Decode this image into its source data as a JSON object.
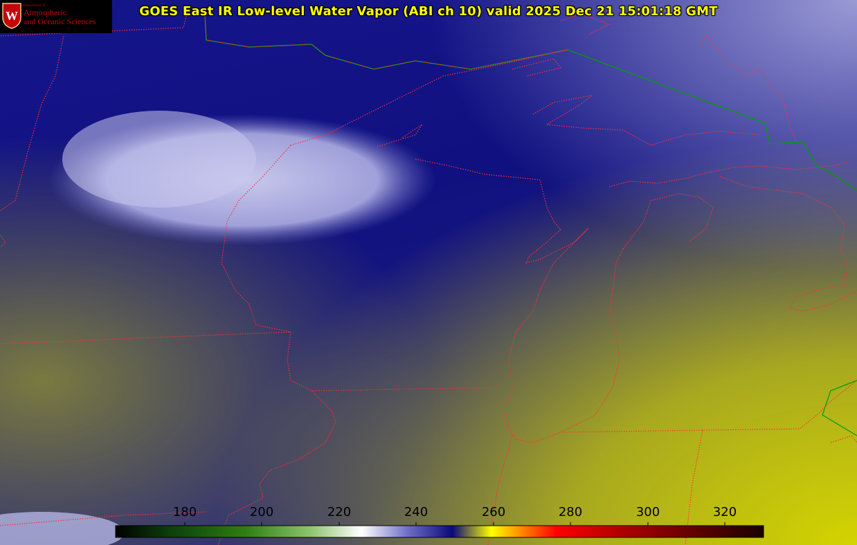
{
  "title": "GOES East IR Low-level Water Vapor (ABI ch 10) valid 2025 Dec 21 15:01:18 GMT",
  "logo": {
    "icon": "uw-crest-icon",
    "dept": "Department of",
    "line1": "Atmospheric",
    "line2": "and Oceanic Sciences"
  },
  "colorbar": {
    "ticks": [
      "180",
      "200",
      "220",
      "240",
      "260",
      "280",
      "300",
      "320"
    ],
    "colors": [
      "#000000",
      "#0c3d0c",
      "#2f7d12",
      "#8cc46c",
      "#ffffff",
      "#6f6fc8",
      "#0a0a7a",
      "#ffff00",
      "#ff9900",
      "#ff0000",
      "#b00000",
      "#5c0000",
      "#1a0000"
    ]
  },
  "colors": {
    "title": "#ffff00",
    "state_borders": "#ff3030",
    "country_border": "#00a000",
    "logo_red": "#c5050c"
  }
}
